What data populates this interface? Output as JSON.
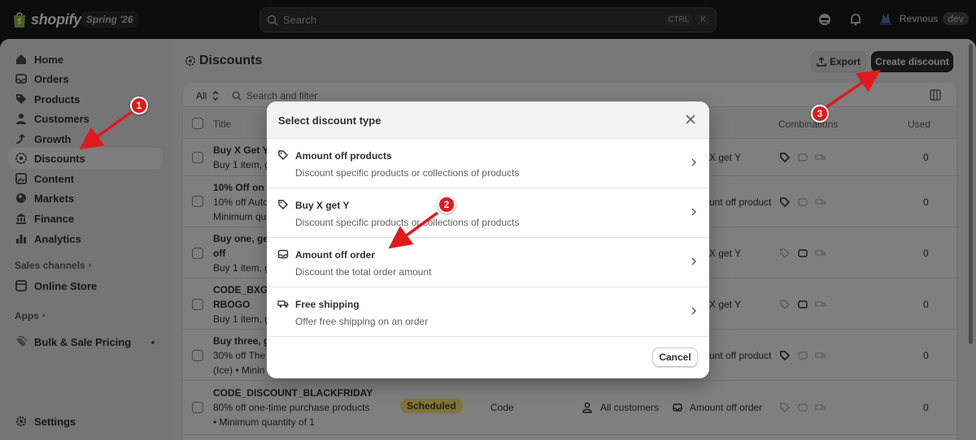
{
  "topbar": {
    "logo_text": "shopify",
    "edition": "Spring '26",
    "search_placeholder": "Search",
    "shortcut_ctrl": "CTRL",
    "shortcut_key": "K",
    "user_name": "Revnous",
    "user_tag": "dev"
  },
  "sidebar": {
    "items": [
      {
        "label": "Home",
        "icon": "home-icon"
      },
      {
        "label": "Orders",
        "icon": "orders-icon"
      },
      {
        "label": "Products",
        "icon": "tag-icon"
      },
      {
        "label": "Customers",
        "icon": "person-icon"
      },
      {
        "label": "Growth",
        "icon": "growth-icon"
      },
      {
        "label": "Discounts",
        "icon": "discount-icon",
        "active": true
      },
      {
        "label": "Content",
        "icon": "content-icon"
      },
      {
        "label": "Markets",
        "icon": "globe-icon"
      },
      {
        "label": "Finance",
        "icon": "bank-icon"
      },
      {
        "label": "Analytics",
        "icon": "chart-icon"
      }
    ],
    "sales_channels_label": "Sales channels",
    "online_store_label": "Online Store",
    "apps_label": "Apps",
    "bulk_sale_label": "Bulk & Sale Pricing",
    "settings_label": "Settings"
  },
  "page": {
    "title": "Discounts",
    "export_label": "Export",
    "create_label": "Create discount"
  },
  "filter": {
    "all_label": "All",
    "search_placeholder": "Search and filter"
  },
  "table": {
    "headers": {
      "title": "Title",
      "combinations": "Combinations",
      "used": "Used"
    },
    "rows": [
      {
        "title": "Buy X Get Y",
        "sub": [
          "Buy 1 item, g"
        ],
        "type_tail": "X get Y",
        "used": "0"
      },
      {
        "title": "10% Off on A",
        "sub": [
          "10% off Auto",
          "Minimum qua"
        ],
        "type_tail": "unt off product",
        "used": "0"
      },
      {
        "title": "Buy one, get",
        "sub": [
          "off",
          "Buy 1 item, g"
        ],
        "type_tail": "X get Y",
        "used": "0"
      },
      {
        "title": "CODE_BXGY",
        "sub": [
          "RBOGO",
          "Buy 1 item, g"
        ],
        "type_tail": "X get Y",
        "used": "0"
      },
      {
        "title": "Buy three, g",
        "sub": [
          "30% off The",
          "(Ice) • Minin"
        ],
        "type_tail": "unt off product",
        "used": "0"
      },
      {
        "title": "CODE_DISCOUNT_BLACKFRIDAY",
        "sub": [
          "80% off one-time purchase products",
          "• Minimum quantity of 1"
        ],
        "status": "Scheduled",
        "method": "Code",
        "eligibility": "All customers",
        "type_tail": "Amount off order",
        "used": "0"
      }
    ]
  },
  "modal": {
    "title": "Select discount type",
    "options": [
      {
        "title": "Amount off products",
        "desc": "Discount specific products or collections of products",
        "icon": "tag-icon"
      },
      {
        "title": "Buy X get Y",
        "desc": "Discount specific products or collections of products",
        "icon": "tag-icon"
      },
      {
        "title": "Amount off order",
        "desc": "Discount the total order amount",
        "icon": "order-icon"
      },
      {
        "title": "Free shipping",
        "desc": "Offer free shipping on an order",
        "icon": "truck-icon"
      }
    ],
    "cancel_label": "Cancel"
  },
  "annotations": {
    "step1": "1",
    "step2": "2",
    "step3": "3",
    "color": "#e0191d"
  }
}
